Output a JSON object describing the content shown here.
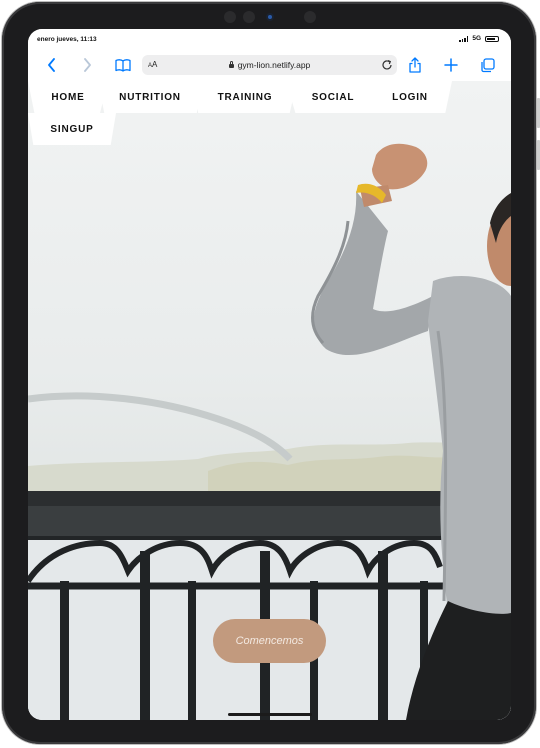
{
  "status_bar": {
    "time": "enero jueves, 11:13",
    "network": "5G"
  },
  "browser": {
    "url": "gym-lion.netlify.app",
    "reader_label_small": "A",
    "reader_label_large": "A"
  },
  "nav": {
    "items": [
      {
        "label": "HOME"
      },
      {
        "label": "NUTRITION"
      },
      {
        "label": "TRAINING"
      },
      {
        "label": "SOCIAL"
      },
      {
        "label": "LOGIN"
      },
      {
        "label": "SINGUP"
      }
    ]
  },
  "hero": {
    "cta_label": "Comencemos"
  },
  "colors": {
    "accent": "#c29a7e",
    "device_bezel": "#1c1c1e",
    "ios_blue": "#007aff"
  },
  "icons": [
    "back-icon",
    "forward-icon",
    "bookmarks-icon",
    "lock-icon",
    "reload-icon",
    "share-icon",
    "new-tab-icon",
    "tabs-icon"
  ]
}
